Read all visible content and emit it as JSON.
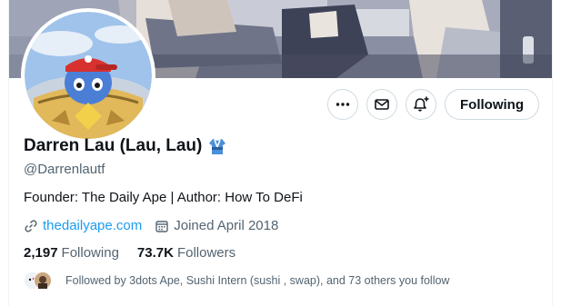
{
  "profile": {
    "display_name": "Darren Lau (Lau, Lau)",
    "badge_emoji": "kimono-emoji",
    "handle": "@Darrenlautf",
    "bio": "Founder: The Daily Ape | Author: How To DeFi",
    "website": "thedailyape.com",
    "joined": "Joined April 2018",
    "following_count": "2,197",
    "following_label": "Following",
    "followers_count": "73.7K",
    "followers_label": "Followers",
    "followed_by": "Followed by 3dots Ape, Sushi Intern (sushi , swap), and 73 others you follow"
  },
  "actions": {
    "more_icon": "more-icon",
    "message_icon": "envelope-icon",
    "notify_icon": "bell-plus-icon",
    "follow_label": "Following"
  },
  "colors": {
    "text_primary": "#0f1419",
    "text_secondary": "#536471",
    "link": "#1d9bf0",
    "border": "#cfd9de"
  }
}
